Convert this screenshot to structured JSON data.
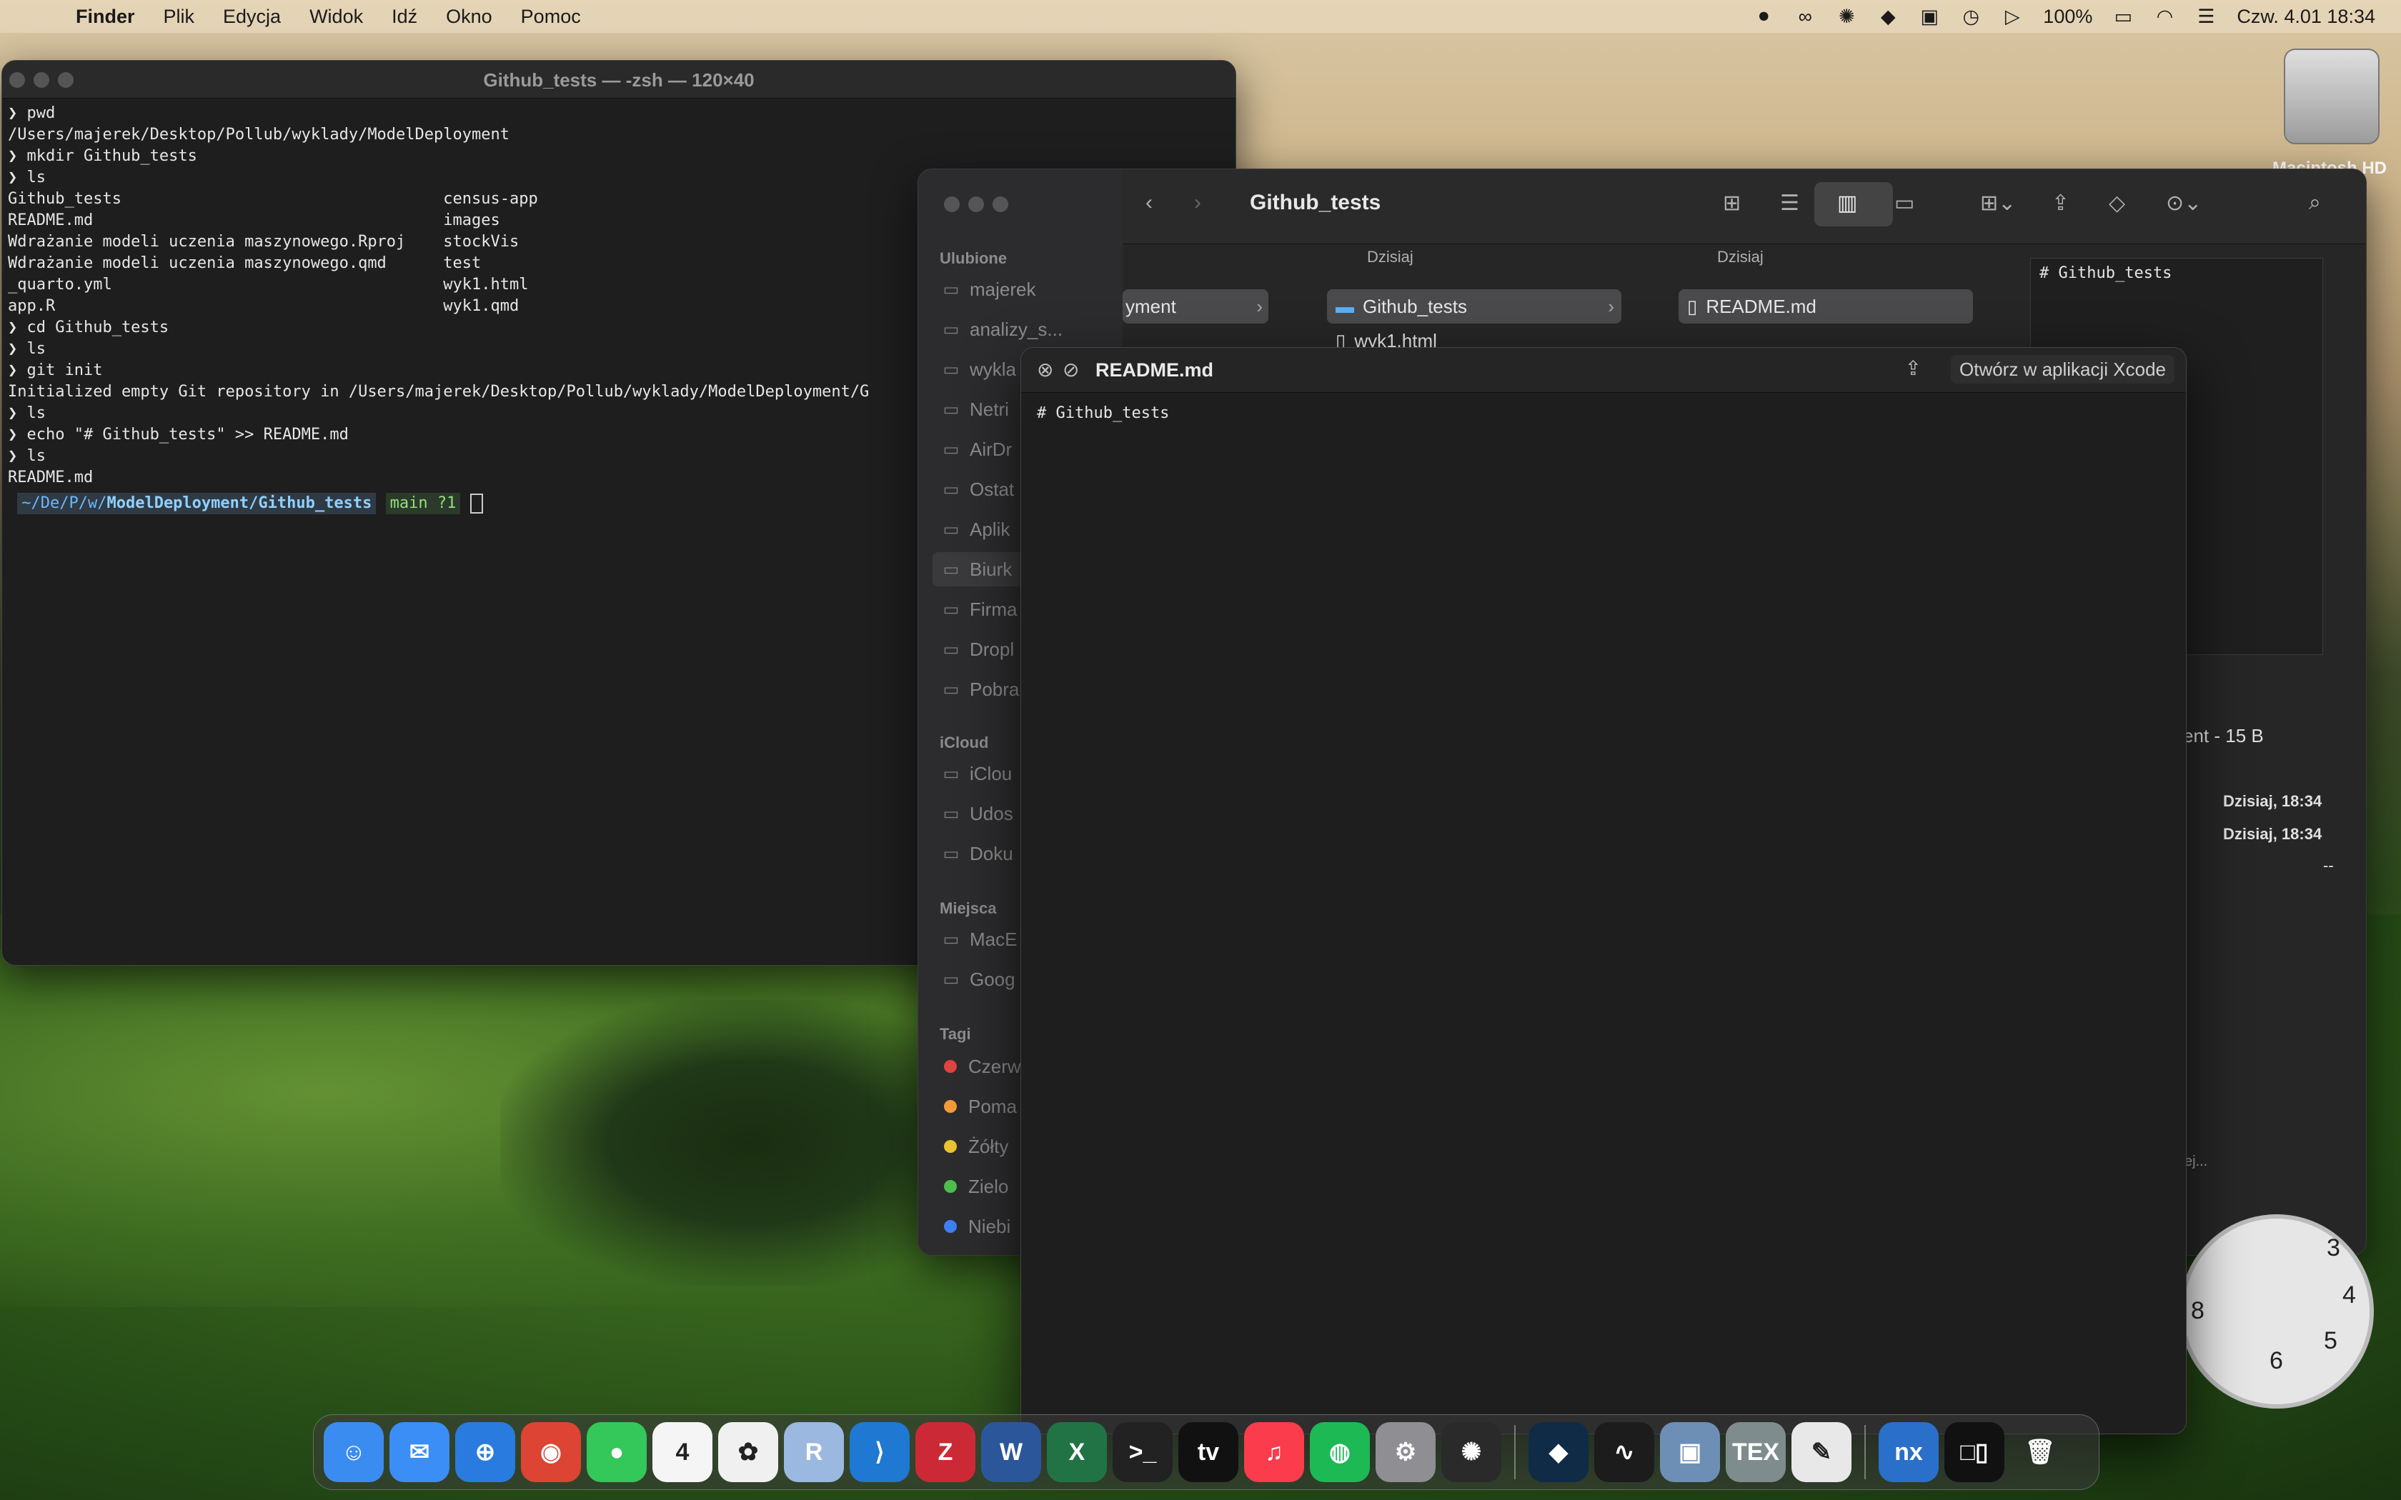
{
  "menubar": {
    "app": "Finder",
    "items": [
      "Plik",
      "Edycja",
      "Widok",
      "Idź",
      "Okno",
      "Pomoc"
    ],
    "battery": "100%",
    "datetime": "Czw. 4.01  18:34"
  },
  "desktop": {
    "hd_label": "Macintosh HD"
  },
  "terminal": {
    "title": "Github_tests — -zsh — 120×40",
    "lines": [
      "❯ pwd",
      "/Users/majerek/Desktop/Pollub/wyklady/ModelDeployment",
      "❯ mkdir Github_tests",
      "❯ ls",
      "Github_tests                                  census-app",
      "README.md                                     images",
      "Wdrażanie modeli uczenia maszynowego.Rproj    stockVis",
      "Wdrażanie modeli uczenia maszynowego.qmd      test",
      "_quarto.yml                                   wyk1.html",
      "app.R                                         wyk1.qmd",
      "❯ cd Github_tests",
      "❯ ls",
      "❯ git init",
      "Initialized empty Git repository in /Users/majerek/Desktop/Pollub/wyklady/ModelDeployment/G",
      "❯ ls",
      "❯ echo \"# Github_tests\" >> README.md",
      "❯ ls",
      "README.md"
    ],
    "prompt_path_prefix": "~/De/P/w/",
    "prompt_path_bold": "ModelDeployment/Github_tests",
    "prompt_git": "main ?1"
  },
  "finder": {
    "title": "Github_tests",
    "sidebar": {
      "favorites_label": "Ulubione",
      "favorites": [
        "majerek",
        "analizy_s...",
        "wykla",
        "Netri",
        "AirDr",
        "Ostat",
        "Aplik",
        "Biurk",
        "Firma",
        "Dropl",
        "Pobra"
      ],
      "icloud_label": "iCloud",
      "icloud": [
        "iClou",
        "Udos",
        "Doku"
      ],
      "places_label": "Miejsca",
      "places": [
        "MacE",
        "Goog"
      ],
      "tags_label": "Tagi",
      "tags": [
        {
          "label": "Czerw",
          "color": "#e0443e"
        },
        {
          "label": "Poma",
          "color": "#f29a38"
        },
        {
          "label": "Żółty",
          "color": "#e8c22f"
        },
        {
          "label": "Zielo",
          "color": "#4cbf4c"
        },
        {
          "label": "Niebi",
          "color": "#3f7ef2"
        }
      ]
    },
    "columns": {
      "col1_item": "yment",
      "col2_head": "Dzisiaj",
      "col2_items": [
        "Github_tests",
        "wyk1.html"
      ],
      "col3_head": "Dzisiaj",
      "col3_items": [
        "README.md"
      ]
    },
    "preview_text": "# Github_tests",
    "info": {
      "kind_size": "ent - 15 B",
      "created": "Dzisiaj, 18:34",
      "modified": "Dzisiaj, 18:34",
      "last_opened": "--",
      "more": "ej..."
    }
  },
  "quicklook": {
    "filename": "README.md",
    "open_button": "Otwórz w aplikacji Xcode",
    "content": "# Github_tests"
  },
  "clock": {
    "numbers": [
      "3",
      "4",
      "5",
      "6",
      "8"
    ]
  },
  "dock": {
    "apps": [
      {
        "name": "finder",
        "glyph": "☺",
        "color": "#3b8cf0"
      },
      {
        "name": "mail",
        "glyph": "✉",
        "color": "#3a8ef5"
      },
      {
        "name": "safari",
        "glyph": "⊕",
        "color": "#2a7be0"
      },
      {
        "name": "chrome",
        "glyph": "◉",
        "color": "#dd4433"
      },
      {
        "name": "messages",
        "glyph": "●",
        "color": "#34c759"
      },
      {
        "name": "calendar",
        "glyph": "4",
        "color": "#f5f5f5"
      },
      {
        "name": "photos",
        "glyph": "✿",
        "color": "#f0f0f0"
      },
      {
        "name": "rstudio",
        "glyph": "R",
        "color": "#9bb8e0"
      },
      {
        "name": "vscode",
        "glyph": "⟩",
        "color": "#1f78d1"
      },
      {
        "name": "zotero",
        "glyph": "Z",
        "color": "#cc2936"
      },
      {
        "name": "word",
        "glyph": "W",
        "color": "#2b579a"
      },
      {
        "name": "excel",
        "glyph": "X",
        "color": "#217346"
      },
      {
        "name": "terminal",
        "glyph": ">_",
        "color": "#222"
      },
      {
        "name": "appletv",
        "glyph": "tv",
        "color": "#111"
      },
      {
        "name": "music",
        "glyph": "♫",
        "color": "#fa3c4c"
      },
      {
        "name": "spotify",
        "glyph": "◍",
        "color": "#1db954"
      },
      {
        "name": "settings",
        "glyph": "⚙",
        "color": "#8e8e93"
      },
      {
        "name": "chatgpt",
        "glyph": "✺",
        "color": "#2a2a2a"
      },
      {
        "name": "sep",
        "glyph": "",
        "color": ""
      },
      {
        "name": "deepl",
        "glyph": "◆",
        "color": "#0f2b46"
      },
      {
        "name": "activity-monitor",
        "glyph": "∿",
        "color": "#1c1c1c"
      },
      {
        "name": "preview",
        "glyph": "▣",
        "color": "#6e8fb5"
      },
      {
        "name": "tex",
        "glyph": "TEX",
        "color": "#7f8c8d"
      },
      {
        "name": "textedit",
        "glyph": "✎",
        "color": "#e8e8e8"
      },
      {
        "name": "sep",
        "glyph": "",
        "color": ""
      },
      {
        "name": "nomachine",
        "glyph": "nx",
        "color": "#2a6fc9"
      },
      {
        "name": "reader",
        "glyph": "□▯",
        "color": "#111"
      },
      {
        "name": "trash",
        "glyph": "🗑",
        "color": "transparent"
      }
    ]
  }
}
